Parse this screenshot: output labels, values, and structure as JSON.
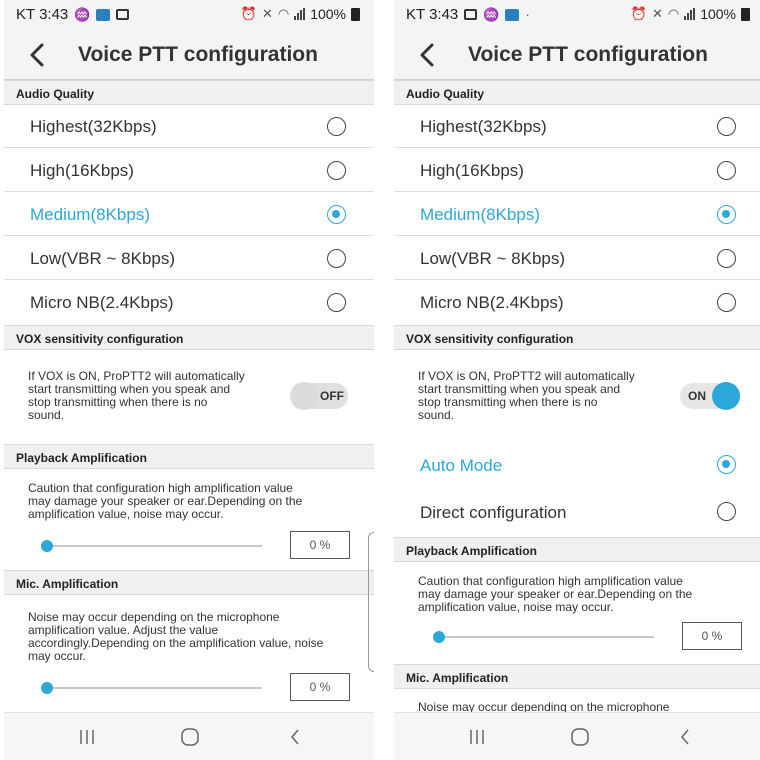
{
  "screens": [
    {
      "status": {
        "carrier_time": "KT 3:43",
        "battery": "100%"
      },
      "title": "Voice PTT configuration",
      "audio_quality": {
        "header": "Audio Quality",
        "options": [
          {
            "label": "Highest(32Kbps)",
            "selected": false
          },
          {
            "label": "High(16Kbps)",
            "selected": false
          },
          {
            "label": "Medium(8Kbps)",
            "selected": true
          },
          {
            "label": "Low(VBR ~ 8Kbps)",
            "selected": false
          },
          {
            "label": "Micro NB(2.4Kbps)",
            "selected": false
          }
        ]
      },
      "vox": {
        "header": "VOX sensitivity configuration",
        "description": [
          "If VOX is ON, ProPTT2 will automatically",
          "start transmitting when you speak and",
          "stop transmitting when there is no",
          "sound."
        ],
        "toggle_label": "OFF",
        "toggle_on": false
      },
      "playback": {
        "header": "Playback Amplification",
        "caution": [
          "Caution that configuration high amplification value",
          "may damage your speaker or ear.Depending on the",
          "amplification value, noise may occur."
        ],
        "value": "0 %"
      },
      "mic": {
        "header": "Mic. Amplification",
        "caution": [
          "Noise may occur depending on the microphone",
          "amplification value. Adjust the value",
          "accordingly.Depending on the amplification value, noise",
          "may occur."
        ],
        "value": "0 %"
      }
    },
    {
      "status": {
        "carrier_time": "KT 3:43",
        "battery": "100%"
      },
      "title": "Voice PTT configuration",
      "audio_quality": {
        "header": "Audio Quality",
        "options": [
          {
            "label": "Highest(32Kbps)",
            "selected": false
          },
          {
            "label": "High(16Kbps)",
            "selected": false
          },
          {
            "label": "Medium(8Kbps)",
            "selected": true
          },
          {
            "label": "Low(VBR ~ 8Kbps)",
            "selected": false
          },
          {
            "label": "Micro NB(2.4Kbps)",
            "selected": false
          }
        ]
      },
      "vox": {
        "header": "VOX sensitivity configuration",
        "description": [
          "If VOX is ON, ProPTT2 will automatically",
          "start transmitting when you speak and",
          "stop transmitting when there is no",
          "sound."
        ],
        "toggle_label": "ON",
        "toggle_on": true,
        "modes": [
          {
            "label": "Auto Mode",
            "selected": true
          },
          {
            "label": "Direct configuration",
            "selected": false
          }
        ]
      },
      "playback": {
        "header": "Playback Amplification",
        "caution": [
          "Caution that configuration high amplification value",
          "may damage your speaker or ear.Depending on the",
          "amplification value, noise may occur."
        ],
        "value": "0 %"
      },
      "mic": {
        "header": "Mic. Amplification",
        "caution_partial": "Noise may occur depending on the microphone"
      }
    }
  ]
}
